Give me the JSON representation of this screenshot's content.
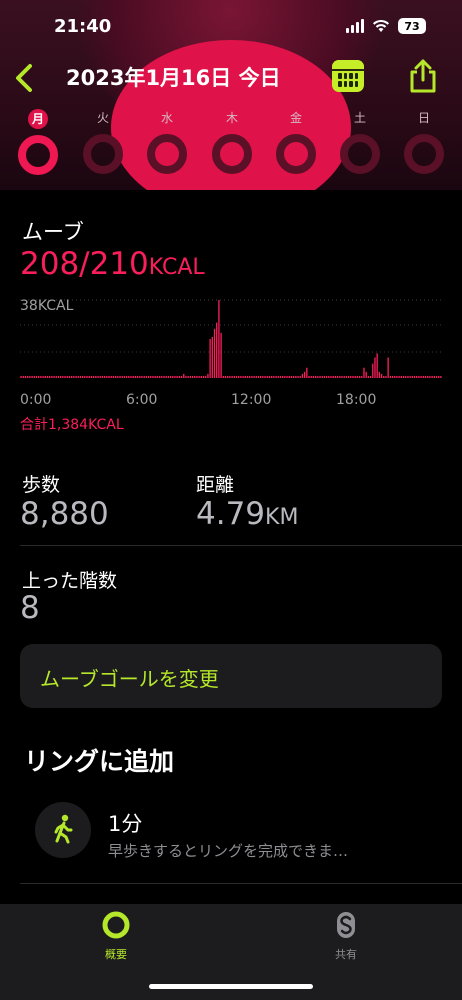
{
  "status_bar": {
    "time": "21:40",
    "battery": "73"
  },
  "nav": {
    "title": "2023年1月16日 今日"
  },
  "week": [
    {
      "label": "月",
      "today": true
    },
    {
      "label": "火",
      "today": false
    },
    {
      "label": "水",
      "today": false
    },
    {
      "label": "木",
      "today": false
    },
    {
      "label": "金",
      "today": false
    },
    {
      "label": "土",
      "today": false
    },
    {
      "label": "日",
      "today": false
    }
  ],
  "move": {
    "label": "ムーブ",
    "value": "208/210",
    "unit": "KCAL",
    "color": "#fa1f5a"
  },
  "chart_data": {
    "type": "bar",
    "max_label": "38KCAL",
    "ylim": [
      0,
      38
    ],
    "x_ticks": [
      "0:00",
      "6:00",
      "12:00",
      "18:00"
    ],
    "total_label": "合計1,384KCAL",
    "bins_per_hour": 4,
    "values": [
      1,
      1,
      1,
      1,
      1,
      1,
      1,
      1,
      1,
      1,
      1,
      1,
      1,
      1,
      1,
      1,
      1,
      1,
      1,
      1,
      1,
      1,
      1,
      1,
      1,
      1,
      1,
      1,
      1,
      1,
      1,
      1,
      1,
      1,
      1,
      1,
      1,
      1,
      1,
      1,
      1,
      1,
      1,
      1,
      1,
      1,
      1,
      1,
      1,
      1,
      1,
      1,
      1,
      1,
      1,
      1,
      1,
      1,
      1,
      1,
      1,
      1,
      1,
      1,
      1,
      1,
      1,
      1,
      1,
      1,
      1,
      1,
      1,
      1,
      2,
      1,
      1,
      1,
      1,
      1,
      1,
      1,
      1,
      1,
      1,
      2,
      19,
      20,
      24,
      27,
      38,
      22,
      1,
      1,
      1,
      1,
      1,
      1,
      1,
      1,
      1,
      1,
      1,
      1,
      1,
      1,
      1,
      1,
      1,
      1,
      1,
      1,
      1,
      1,
      1,
      1,
      1,
      1,
      1,
      1,
      1,
      1,
      1,
      1,
      1,
      1,
      1,
      1,
      2,
      3,
      5,
      1,
      1,
      1,
      1,
      1,
      1,
      1,
      1,
      1,
      1,
      1,
      1,
      1,
      1,
      1,
      1,
      1,
      1,
      1,
      1,
      1,
      1,
      1,
      1,
      1,
      5,
      3,
      1,
      1,
      7,
      10,
      12,
      3,
      2,
      1,
      1,
      10,
      1,
      1,
      1,
      1,
      1,
      1,
      1,
      1,
      1,
      1,
      1,
      1,
      1,
      1,
      1,
      1,
      1,
      1,
      1,
      1,
      1,
      1,
      1,
      1
    ]
  },
  "stats": {
    "steps": {
      "label": "歩数",
      "value": "8,880"
    },
    "distance": {
      "label": "距離",
      "value": "4.79",
      "unit": "KM"
    },
    "floors": {
      "label": "上った階数",
      "value": "8"
    }
  },
  "goal_button": {
    "label": "ムーブゴールを変更"
  },
  "add_to_ring": {
    "title": "リングに追加",
    "item_title": "1分",
    "item_desc": "早歩きするとリングを完成できま…"
  },
  "tabs": [
    {
      "label": "概要",
      "active": true,
      "icon": "activity-rings-icon"
    },
    {
      "label": "共有",
      "active": false,
      "icon": "sharing-icon"
    }
  ],
  "colors": {
    "accent": "#b5e82a",
    "move": "#fa1f5a"
  }
}
